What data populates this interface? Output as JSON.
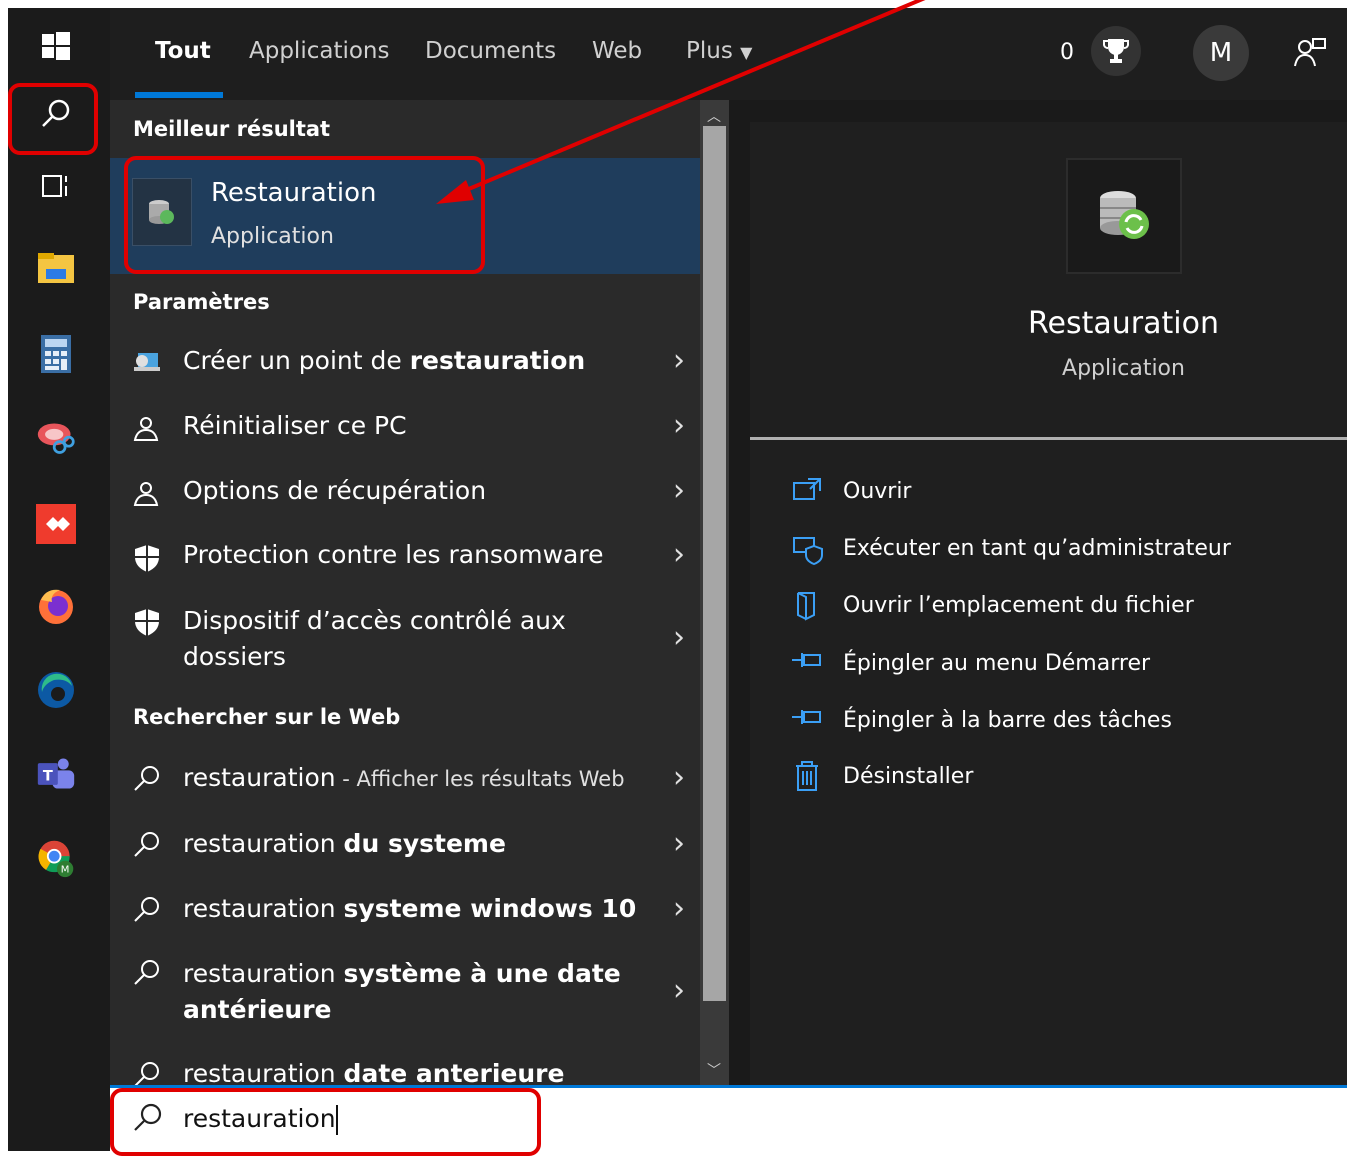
{
  "tabs": {
    "all": "Tout",
    "apps": "Applications",
    "documents": "Documents",
    "web": "Web",
    "more": "Plus"
  },
  "header": {
    "points": "0",
    "avatar_letter": "M"
  },
  "best_match": {
    "heading": "Meilleur résultat",
    "title": "Restauration",
    "subtitle": "Application"
  },
  "settings": {
    "heading": "Paramètres",
    "items": [
      {
        "text_plain": "Créer un point de ",
        "text_bold": "restauration"
      },
      {
        "text_plain": "Réinitialiser ce PC"
      },
      {
        "text_plain": "Options de récupération"
      },
      {
        "text_plain": "Protection contre les ransomware"
      },
      {
        "text_plain": "Dispositif d’accès contrôlé aux",
        "text_line2": "dossiers"
      }
    ]
  },
  "web": {
    "heading": "Rechercher sur le Web",
    "items": [
      {
        "text_plain": "restauration",
        "text_suffix": " - Afficher les résultats Web"
      },
      {
        "text_plain": "restauration ",
        "text_bold": "du systeme"
      },
      {
        "text_plain": "restauration ",
        "text_bold": "systeme windows 10"
      },
      {
        "text_plain": "restauration ",
        "text_bold": "système à une date",
        "text_line2": "antérieure"
      },
      {
        "text_plain": "restauration ",
        "text_bold": "date anterieure"
      }
    ]
  },
  "preview": {
    "title": "Restauration",
    "subtitle": "Application",
    "actions": [
      {
        "label": "Ouvrir",
        "icon": "open-icon"
      },
      {
        "label": "Exécuter en tant qu’administrateur",
        "icon": "run-as-admin-icon"
      },
      {
        "label": "Ouvrir l’emplacement du fichier",
        "icon": "file-location-icon"
      },
      {
        "label": "Épingler au menu Démarrer",
        "icon": "pin-icon"
      },
      {
        "label": "Épingler à la barre des tâches",
        "icon": "pin-icon"
      },
      {
        "label": "Désinstaller",
        "icon": "trash-icon"
      }
    ]
  },
  "search": {
    "value": "restauration"
  },
  "colors": {
    "accent": "#0078d7",
    "highlight": "#e00000",
    "selected_bg": "#1f3d5c"
  }
}
